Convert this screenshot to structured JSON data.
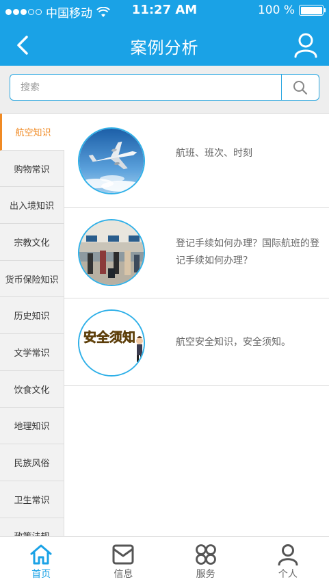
{
  "status_bar": {
    "carrier": "中国移动",
    "time": "11:27 AM",
    "battery_text": "100 %"
  },
  "header": {
    "title": "案例分析",
    "background_color": "#1aa2e6"
  },
  "search": {
    "placeholder": "搜索",
    "value": ""
  },
  "sidebar": {
    "active_color": "#f08a24",
    "items": [
      {
        "label": "航空知识",
        "active": true
      },
      {
        "label": "购物常识"
      },
      {
        "label": "出入境知识"
      },
      {
        "label": "宗教文化"
      },
      {
        "label": "货币保险知识"
      },
      {
        "label": "历史知识"
      },
      {
        "label": "文学常识"
      },
      {
        "label": "饮食文化"
      },
      {
        "label": "地理知识"
      },
      {
        "label": "民族风俗"
      },
      {
        "label": "卫生常识"
      },
      {
        "label": "政策法规"
      }
    ]
  },
  "cases": [
    {
      "text": "航班、班次、时刻",
      "icon": "airplane-thumbnail"
    },
    {
      "text": "登记手续如何办理？国际航班的登记手续如何办理？",
      "icon": "check-in-counter-thumbnail"
    },
    {
      "text": "航空安全知识，安全须知。",
      "icon": "safety-notice-thumbnail",
      "thumb_caption": "安全须知"
    }
  ],
  "tabbar": {
    "active_color": "#1aa2e6",
    "items": [
      {
        "label": "首页",
        "icon": "home-icon",
        "active": true
      },
      {
        "label": "信息",
        "icon": "message-icon"
      },
      {
        "label": "服务",
        "icon": "services-icon"
      },
      {
        "label": "个人",
        "icon": "person-icon"
      }
    ]
  }
}
